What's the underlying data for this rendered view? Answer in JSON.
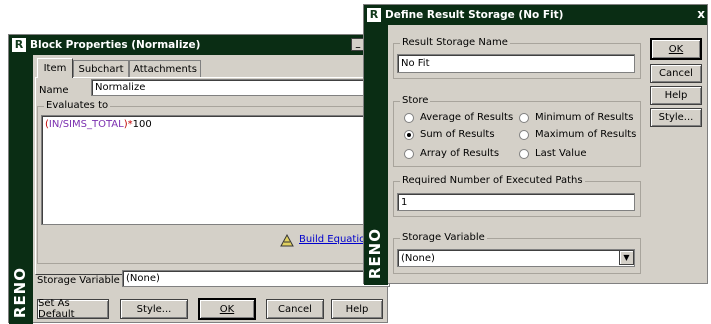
{
  "block_properties": {
    "title": "Block Properties (Normalize)",
    "logo": "R",
    "side_brand": "RENO",
    "tabs": [
      {
        "label": "Item",
        "active": true
      },
      {
        "label": "Subchart",
        "active": false
      },
      {
        "label": "Attachments",
        "active": false
      }
    ],
    "name_label": "Name",
    "name_value": "Normalize",
    "evaluates_label": "Evaluates to",
    "expression_paren_open": "(",
    "expression_var": "IN/SIMS_TOTAL",
    "expression_paren_close": ")",
    "expression_op": "*",
    "expression_num": "100",
    "build_equation_label": "Build Equation...",
    "storage_variable_label": "Storage Variable",
    "storage_variable_value": "(None)",
    "buttons": {
      "set_as_default": "Set As Default",
      "style": "Style...",
      "ok": "OK",
      "cancel": "Cancel",
      "help": "Help"
    },
    "title_button_glyph": "_",
    "colors": {
      "title_bg": "#0a2d14",
      "expr_paren": "#c00000",
      "expr_var": "#7b2fb0",
      "link": "#0000cc"
    }
  },
  "define_result_storage": {
    "title": "Define Result Storage (No Fit)",
    "logo": "R",
    "side_brand": "RENO",
    "close_glyph": "x",
    "result_storage_name_label": "Result Storage Name",
    "result_storage_name_value": "No Fit",
    "store_label": "Store",
    "store_options": [
      {
        "label": "Average of Results",
        "selected": false
      },
      {
        "label": "Minimum of Results",
        "selected": false
      },
      {
        "label": "Sum of Results",
        "selected": true
      },
      {
        "label": "Maximum of Results",
        "selected": false
      },
      {
        "label": "Array of Results",
        "selected": false
      },
      {
        "label": "Last Value",
        "selected": false
      }
    ],
    "required_paths_label": "Required Number of Executed Paths",
    "required_paths_value": "1",
    "storage_variable_label": "Storage Variable",
    "storage_variable_value": "(None)",
    "buttons": {
      "ok": "OK",
      "cancel": "Cancel",
      "help": "Help",
      "style": "Style..."
    }
  }
}
